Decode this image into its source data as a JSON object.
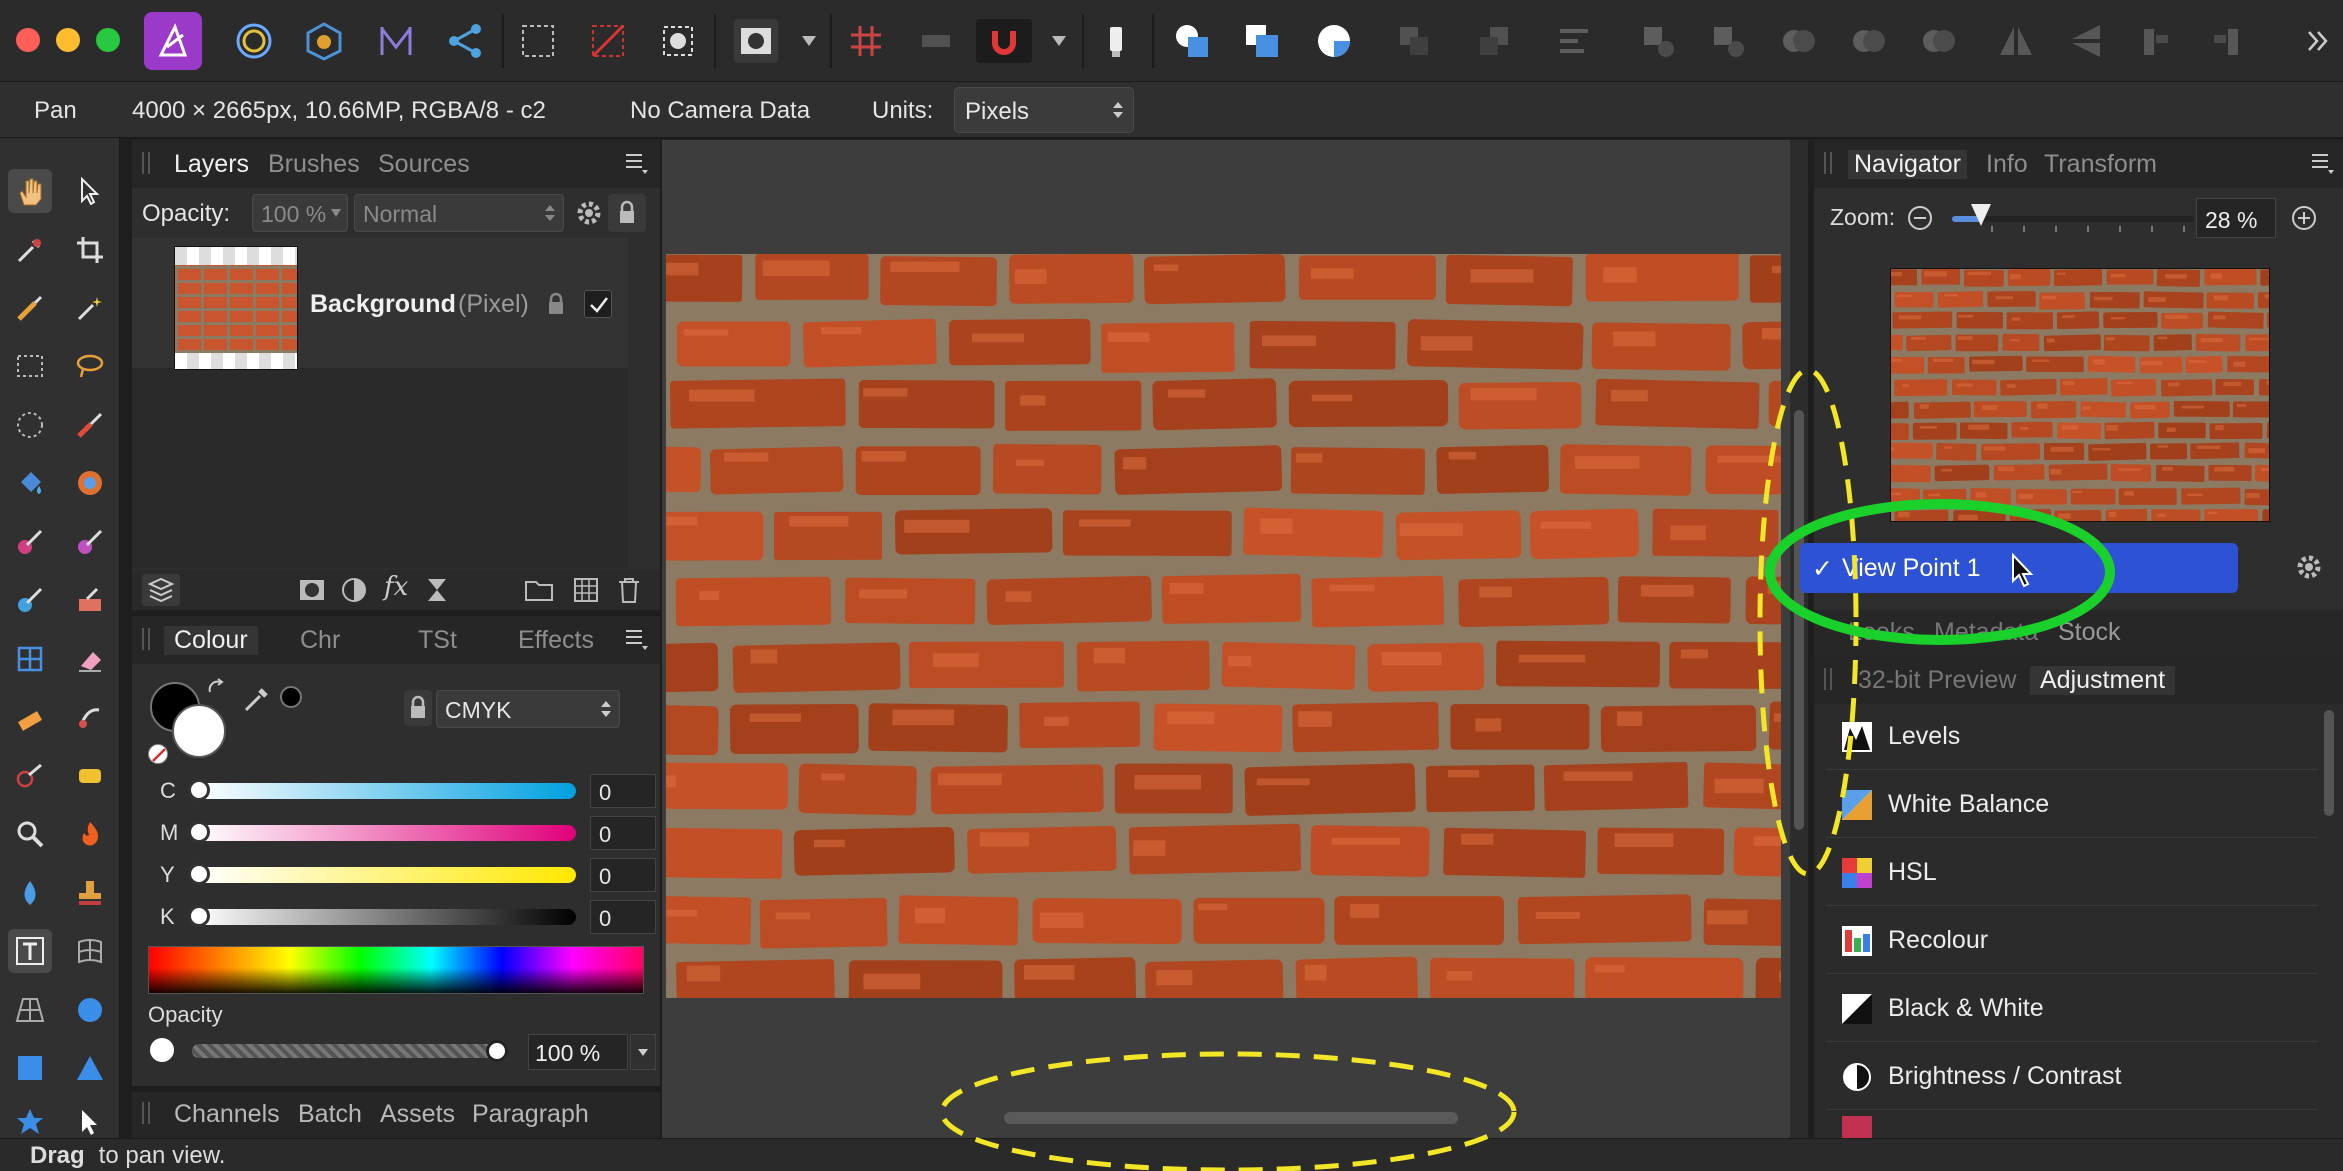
{
  "toolbar": {
    "icons": [
      "persona-photo-icon",
      "develop-persona-icon",
      "liquify-persona-icon",
      "tone-map-persona-icon",
      "export-persona-icon",
      "marquee-icon",
      "crop-off-icon",
      "mask-icon",
      "quick-mask-icon",
      "grid-icon",
      "snap-icon",
      "magnet-icon",
      "inpaint-icon",
      "boolean-add-icon",
      "boolean-subtract-icon",
      "boolean-intersect-icon"
    ]
  },
  "context": {
    "tool_name": "Pan",
    "doc_info": "4000 × 2665px, 10.66MP, RGBA/8 - c2",
    "camera": "No Camera Data",
    "units_label": "Units:",
    "units_value": "Pixels"
  },
  "layers_panel": {
    "tabs": [
      "Layers",
      "Brushes",
      "Sources"
    ],
    "opacity_label": "Opacity:",
    "opacity_value": "100 %",
    "blend_mode": "Normal",
    "layer": {
      "name": "Background",
      "type": "(Pixel)",
      "visible": true
    }
  },
  "colour_panel": {
    "tabs": [
      "Colour",
      "Chr",
      "TSt",
      "Effects"
    ],
    "model": "CMYK",
    "sliders": [
      {
        "label": "C",
        "value": "0"
      },
      {
        "label": "M",
        "value": "0"
      },
      {
        "label": "Y",
        "value": "0"
      },
      {
        "label": "K",
        "value": "0"
      }
    ],
    "opacity_label": "Opacity",
    "opacity_value": "100 %"
  },
  "bottom_tabs": [
    "Channels",
    "Batch",
    "Assets",
    "Paragraph"
  ],
  "navigator": {
    "tabs": [
      "Navigator",
      "Info",
      "Transform"
    ],
    "zoom_label": "Zoom:",
    "zoom_value": "28 %",
    "zoom_fraction": 0.12,
    "view_point": "View Point 1",
    "checkmark": "✓"
  },
  "lower_tabs": {
    "row1": [
      "Looks",
      "Metadata",
      "Stock"
    ],
    "row2": [
      "32-bit Preview",
      "Adjustment"
    ]
  },
  "adjustments": [
    {
      "label": "Levels",
      "icon": "levels-icon"
    },
    {
      "label": "White Balance",
      "icon": "white-balance-icon"
    },
    {
      "label": "HSL",
      "icon": "hsl-icon"
    },
    {
      "label": "Recolour",
      "icon": "recolour-icon"
    },
    {
      "label": "Black & White",
      "icon": "black-white-icon"
    },
    {
      "label": "Brightness / Contrast",
      "icon": "brightness-contrast-icon"
    }
  ],
  "status": {
    "action": "Drag",
    "hint": " to pan view."
  },
  "colors": {
    "accent_blue": "#2d52d6",
    "highlight_green": "#19d12a",
    "highlight_yellow": "#f2e626",
    "brick": "#c8522a",
    "mortar": "#8c7a63"
  }
}
